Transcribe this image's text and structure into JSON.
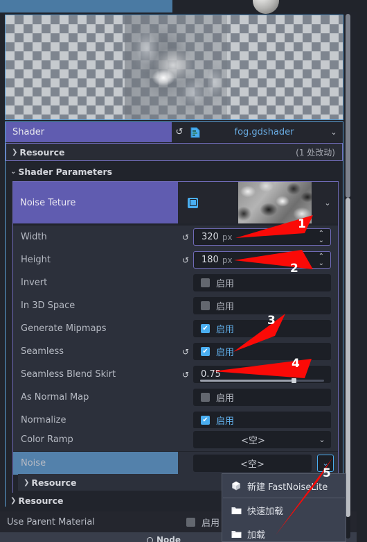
{
  "window": {
    "tab_strip_visible": true
  },
  "preview": {
    "name": "texture-preview",
    "alpha_checker": true
  },
  "shader_header": {
    "label": "Shader",
    "file": "fog.gdshader",
    "reset_icon": "revert-icon",
    "file_icon": "script-file-icon",
    "dropdown_icon": "chevron-down-icon"
  },
  "resource_top": {
    "label": "Resource",
    "changes": "(1 处改动)",
    "expand_icon": "chevron-right-icon"
  },
  "shader_parameters": {
    "label": "Shader Parameters",
    "collapse_icon": "chevron-down-icon"
  },
  "noise_texture": {
    "label": "Noise Teture",
    "thumb_icon": "image-icon",
    "dropdown_icon": "chevron-down-icon"
  },
  "properties": [
    {
      "label": "Width",
      "type": "number",
      "value": "320",
      "unit": "px",
      "revert": true,
      "spinner": true
    },
    {
      "label": "Height",
      "type": "number",
      "value": "180",
      "unit": "px",
      "revert": true,
      "spinner": true
    },
    {
      "label": "Invert",
      "type": "checkbox",
      "value": "启用",
      "checked": false,
      "revert": false
    },
    {
      "label": "In 3D Space",
      "type": "checkbox",
      "value": "启用",
      "checked": false,
      "revert": false
    },
    {
      "label": "Generate Mipmaps",
      "type": "checkbox",
      "value": "启用",
      "checked": true,
      "revert": false
    },
    {
      "label": "Seamless",
      "type": "checkbox",
      "value": "启用",
      "checked": true,
      "revert": true
    },
    {
      "label": "Seamless Blend Skirt",
      "type": "slider",
      "value": "0.75",
      "revert": true,
      "slider_pct": 74
    },
    {
      "label": "As Normal Map",
      "type": "checkbox",
      "value": "启用",
      "checked": false,
      "revert": false
    },
    {
      "label": "Normalize",
      "type": "checkbox",
      "value": "启用",
      "checked": true,
      "revert": false
    },
    {
      "label": "Color Ramp",
      "type": "resource",
      "value": "<空>",
      "revert": false
    },
    {
      "label": "Noise",
      "type": "resource",
      "value": "<空>",
      "revert": false,
      "selected": true
    }
  ],
  "resource_inner": {
    "label": "Resource",
    "expand_icon": "chevron-right-icon"
  },
  "resource_outer": {
    "label": "Resource",
    "expand_icon": "chevron-right-icon"
  },
  "use_parent_material": {
    "label": "Use Parent Material",
    "value": "启用",
    "checked": false
  },
  "bottom_tab": {
    "label": "Node",
    "icon": "node-circle-icon"
  },
  "popup_menu": {
    "items": [
      {
        "label": "新建 FastNoiseLite",
        "icon": "new-resource-icon"
      },
      {
        "label": "快速加载",
        "icon": "folder-icon"
      },
      {
        "label": "加载",
        "icon": "folder-icon"
      }
    ]
  },
  "annotations": [
    {
      "number": "1",
      "target": "width-field"
    },
    {
      "number": "2",
      "target": "height-field"
    },
    {
      "number": "3",
      "target": "generate-mipmaps-checkbox"
    },
    {
      "number": "4",
      "target": "seamless-blend-skirt-field"
    },
    {
      "number": "5",
      "target": "noise-dropdown-button"
    }
  ],
  "colors": {
    "accent_purple": "#605cb0",
    "accent_blue": "#4aaef0",
    "selection_blue": "#5381ab",
    "panel_bg": "#21242c",
    "row_bg": "#2c303b",
    "field_bg": "#1c1f26",
    "border_blue": "#5a9cd0",
    "annotation_red": "#fb0a07"
  }
}
